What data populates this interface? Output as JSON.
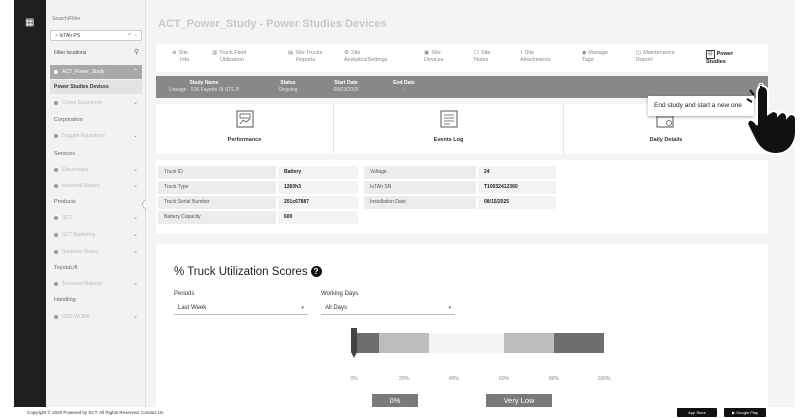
{
  "sidebar": {
    "search_label": "Search/Filter",
    "search_value": "IsTAh PS",
    "filter_label": "Filter locations",
    "items": [
      {
        "label": "ACT_Power_Study",
        "active": true
      },
      {
        "label": "Power Studies Devices",
        "selected": true
      },
      {
        "label": "Crown Equipment"
      },
      {
        "section": "Corporation"
      },
      {
        "label": "Doggett Equipment"
      },
      {
        "section": "Services"
      },
      {
        "label": "Electrovaya"
      },
      {
        "label": "Industrial Battery"
      },
      {
        "section": "Products"
      },
      {
        "label": "SCT"
      },
      {
        "label": "SCT Marketing"
      },
      {
        "label": "Southern States"
      },
      {
        "section": "ToyotaLift"
      },
      {
        "label": "Tonomori Material"
      },
      {
        "section": "Handling"
      },
      {
        "label": "USG WORK"
      }
    ]
  },
  "page": {
    "title": "ACT_Power_Study - Power Studies Devices"
  },
  "tabs": [
    {
      "icon": "building-icon",
      "line1": "Site",
      "line2": "Info"
    },
    {
      "icon": "bar-chart-icon",
      "line1": "Truck Fleet",
      "line2": "Utilization"
    },
    {
      "icon": "report-icon",
      "line1": "Site Trucks",
      "line2": "Reports"
    },
    {
      "icon": "gear-icon",
      "line1": "Site",
      "line2": "Analytics/Settings"
    },
    {
      "icon": "devices-icon",
      "line1": "Site",
      "line2": "Devices"
    },
    {
      "icon": "note-icon",
      "line1": "Site",
      "line2": "Notes"
    },
    {
      "icon": "paperclip-icon",
      "line1": "Site",
      "line2": "Attachments"
    },
    {
      "icon": "tag-icon",
      "line1": "Manage",
      "line2": "Tags"
    },
    {
      "icon": "maintenance-icon",
      "line1": "Maintenance",
      "line2": "Report"
    },
    {
      "icon": "power-icon",
      "line1": "Power",
      "line2": "Studies",
      "active": true
    }
  ],
  "study": {
    "name_label": "Study Name",
    "name_value": "Lineage - 536 Fayette St STE B",
    "status_label": "Status",
    "status_value": "Ongoing",
    "start_label": "Start Date",
    "start_value": "08/03/2025",
    "end_label": "End Date",
    "end_value": "-"
  },
  "tooltip": {
    "text": "End study and start a new one"
  },
  "report_cards": [
    {
      "label": "Performance",
      "icon": "performance-icon"
    },
    {
      "label": "Events Log",
      "icon": "events-log-icon"
    },
    {
      "label": "Daily Details",
      "icon": "calendar-icon"
    }
  ],
  "truck_info": {
    "rows_left": [
      {
        "key": "Truck ID",
        "value": "Battery"
      },
      {
        "key": "Truck Type",
        "value": "1260h3"
      },
      {
        "key": "Truck Serial Number",
        "value": "201c67887"
      },
      {
        "key": "Battery Capacity",
        "value": "600"
      }
    ],
    "rows_right": [
      {
        "key": "Voltage",
        "value": "24"
      },
      {
        "key": "IoTAh SN",
        "value": "T10032412360"
      },
      {
        "key": "Installation Date",
        "value": "08/15/2025"
      }
    ]
  },
  "utilization": {
    "title": "% Truck Utilization Scores",
    "periods_label": "Periods",
    "periods_value": "Last Week",
    "working_days_label": "Working Days",
    "working_days_value": "All Days",
    "ticks": [
      "0%",
      "20%",
      "40%",
      "60%",
      "80%",
      "100%"
    ],
    "segments": [
      {
        "from": 0,
        "to": 10,
        "color": "#6e6e6e"
      },
      {
        "from": 10,
        "to": 30,
        "color": "#bdbdbd"
      },
      {
        "from": 30,
        "to": 60,
        "color": "#f5f5f5"
      },
      {
        "from": 60,
        "to": 80,
        "color": "#bdbdbd"
      },
      {
        "from": 80,
        "to": 100,
        "color": "#6e6e6e"
      }
    ],
    "marker_value": 0,
    "score_value": "0%",
    "score_rating": "Very Low"
  },
  "footer": {
    "copyright": "Copyright © 2025 Powered by SCT. All Rights Reserved. Contact Us",
    "app_store": "App Store",
    "google_play": "Google Play"
  },
  "colors": {
    "header_bar": "#888888",
    "frame": "#2b2b2b",
    "pill": "#7a7a7a"
  }
}
